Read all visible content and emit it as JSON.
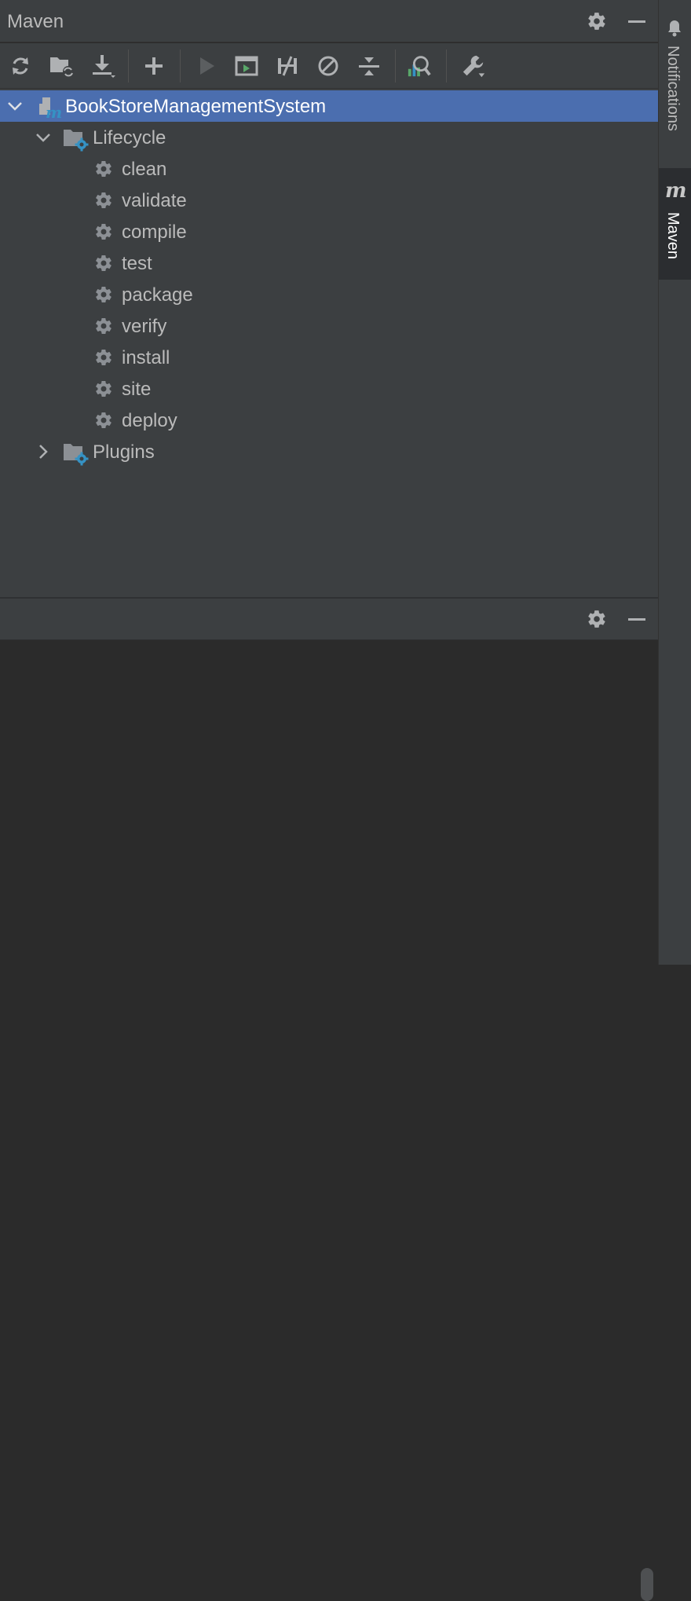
{
  "panel": {
    "title": "Maven",
    "settings_icon": "gear-icon",
    "hide_icon": "minus-icon"
  },
  "toolbar": {
    "buttons": [
      {
        "name": "reload-all-projects-button",
        "icon": "refresh-icon"
      },
      {
        "name": "generate-sources-button",
        "icon": "folder-refresh-icon"
      },
      {
        "name": "download-sources-button",
        "icon": "download-icon"
      },
      {
        "name": "add-maven-project-button",
        "icon": "plus-icon"
      },
      {
        "name": "run-maven-build-button",
        "icon": "run-icon"
      },
      {
        "name": "execute-maven-goal-button",
        "icon": "terminal-icon"
      },
      {
        "name": "toggle-offline-mode-button",
        "icon": "offline-icon"
      },
      {
        "name": "skip-tests-button",
        "icon": "skip-icon"
      },
      {
        "name": "collapse-all-button",
        "icon": "collapse-icon"
      },
      {
        "name": "analyze-dependencies-button",
        "icon": "analyze-icon"
      },
      {
        "name": "build-tool-settings-button",
        "icon": "wrench-icon"
      }
    ]
  },
  "tree": {
    "project": "BookStoreManagementSystem",
    "lifecycle_label": "Lifecycle",
    "goals": [
      "clean",
      "validate",
      "compile",
      "test",
      "package",
      "verify",
      "install",
      "site",
      "deploy"
    ],
    "plugins_label": "Plugins"
  },
  "stripe": {
    "notifications_label": "Notifications",
    "maven_label": "Maven",
    "maven_logo": "m"
  },
  "colors": {
    "panel_bg": "#3c3f41",
    "console_bg": "#2b2b2b",
    "selection": "#4b6eaf",
    "accent_blue": "#3592c4"
  }
}
